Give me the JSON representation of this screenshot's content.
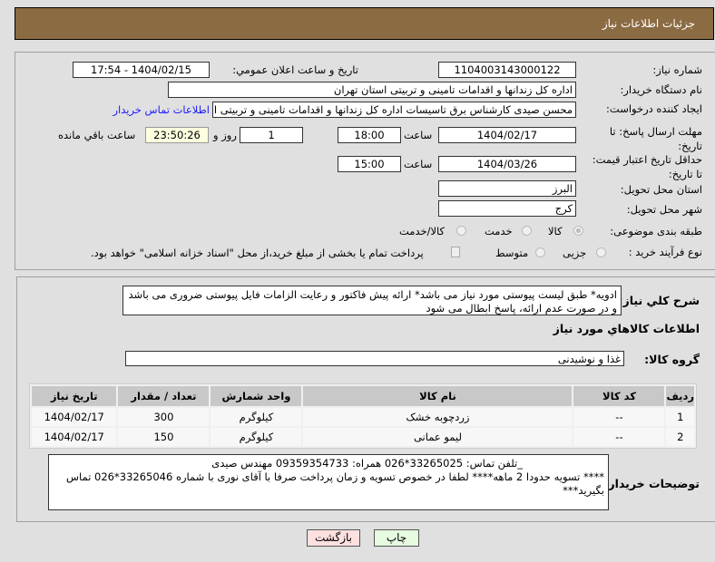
{
  "header": {
    "title": "جزئيات اطلاعات نياز"
  },
  "form": {
    "need_number_label": "شماره نیاز:",
    "need_number": "1104003143000122",
    "announce_label": "تاریخ و ساعت اعلان عمومي:",
    "announce_value": "1404/02/15 - 17:54",
    "buyer_org_label": "نام دستگاه خریدار:",
    "buyer_org": "اداره کل زندانها و اقدامات تامینی و تربیتی استان تهران",
    "creator_label": "ایجاد کننده درخواست:",
    "creator": "محسن صیدی کارشناس برق تاسیسات  اداره کل زندانها و اقدامات تامینی و تربیتی استان تهران",
    "contact_link": "اطلاعات تماس خریدار",
    "deadline_label": "مهلت ارسال پاسخ: تا تاریخ:",
    "deadline_date": "1404/02/17",
    "time_label": "ساعت",
    "deadline_time": "18:00",
    "days": "1",
    "days_label": "روز و",
    "remaining": "23:50:26",
    "remaining_label": "ساعت باقي مانده",
    "validity_label": "حداقل تاریخ اعتبار قیمت: تا تاریخ:",
    "validity_date": "1404/03/26",
    "validity_time": "15:00",
    "province_label": "استان محل تحویل:",
    "province": "البرز",
    "city_label": "شهر محل تحویل:",
    "city": "کرج",
    "category_label": "طبقه بندی موضوعی:",
    "category_options": [
      "کالا",
      "خدمت",
      "کالا/خدمت"
    ],
    "process_label": "نوع فرآیند خرید :",
    "process_options": [
      "جزیی",
      "متوسط"
    ],
    "treasury_note": "پرداخت تمام یا بخشی از مبلغ خرید،از محل \"اسناد خزانه اسلامی\" خواهد بود."
  },
  "details": {
    "desc_label": "شرح کلي نياز:",
    "desc": "ادویه* طبق لیست پیوستی مورد نیاز می باشد* ارائه پیش فاکتور و رعایت الزامات فایل پیوستی ضروری می باشد و در صورت عدم ارائه، پاسخ ابطال می شود",
    "section_title": "اطلاعات کالاهاي مورد نياز",
    "group_label": "گروه کالا:",
    "group": "غذا و نوشیدنی",
    "columns": [
      "ردیف",
      "کد کالا",
      "نام کالا",
      "واحد شمارش",
      "تعداد / مقدار",
      "تاریخ نیاز"
    ],
    "rows": [
      [
        "1",
        "--",
        "زردچوبه خشک",
        "کیلوگرم",
        "300",
        "1404/02/17"
      ],
      [
        "2",
        "--",
        "لیمو عمانی",
        "کیلوگرم",
        "150",
        "1404/02/17"
      ]
    ],
    "notes_label": "توضیحات خریدار:",
    "notes_line1": "_تلفن تماس: 33265025*026       همراه: 09359354733      مهندس صیدی",
    "notes_line2": "**** تسویه حدودا 2 ماهه**** لطفا در خصوص تسویه و زمان پرداخت صرفا با آقای نوری با شماره 33265046*026 تماس بگیرید***"
  },
  "buttons": {
    "back": "بازگشت",
    "print": "چاپ"
  }
}
